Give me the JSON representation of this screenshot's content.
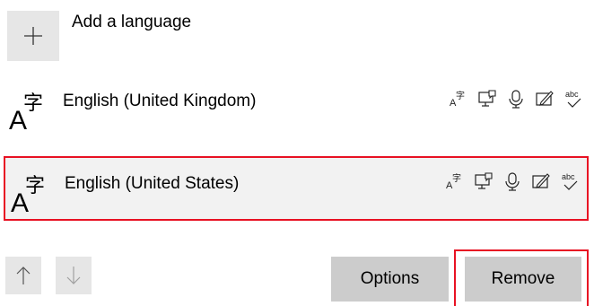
{
  "add_language": {
    "label": "Add a language",
    "icon": "plus-icon"
  },
  "languages": [
    {
      "name": "English (United Kingdom)",
      "icon": "language-glyph-icon",
      "features": [
        "language-pack-icon",
        "display-language-icon",
        "speech-icon",
        "handwriting-icon",
        "spelling-icon"
      ],
      "selected": false
    },
    {
      "name": "English (United States)",
      "icon": "language-glyph-icon",
      "features": [
        "language-pack-icon",
        "display-language-icon",
        "speech-icon",
        "handwriting-icon",
        "spelling-icon"
      ],
      "selected": true
    }
  ],
  "controls": {
    "move_up_icon": "arrow-up-icon",
    "move_down_icon": "arrow-down-icon",
    "options_label": "Options",
    "remove_label": "Remove"
  },
  "colors": {
    "highlight": "#e81123",
    "button_bg": "#cccccc",
    "selected_row_bg": "#f2f2f2",
    "disabled_icon": "#a0a0a0"
  }
}
